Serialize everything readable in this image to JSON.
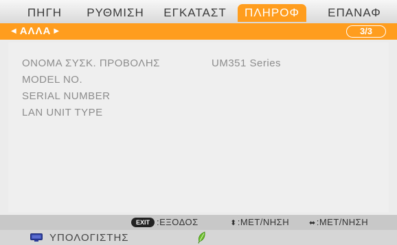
{
  "menu": {
    "tabs": [
      {
        "label": "ΠΗΓΗ",
        "active": false
      },
      {
        "label": "ΡΥΘΜΙΣΗ",
        "active": false
      },
      {
        "label": "ΕΓΚΑΤΑΣΤ",
        "active": false
      },
      {
        "label": "ΠΛΗΡΟΦ",
        "active": true
      },
      {
        "label": "ΕΠΑΝΑΦ",
        "active": false
      }
    ]
  },
  "subheader": {
    "title": "ΑΛΛΑ",
    "left_arrow": "◀",
    "right_arrow": "▶",
    "page_indicator": "3/3"
  },
  "info": {
    "rows": [
      {
        "label": "ΟΝΟΜΑ ΣΥΣΚ. ΠΡΟΒΟΛΗΣ",
        "value": "UM351 Series"
      },
      {
        "label": "MODEL NO.",
        "value": ""
      },
      {
        "label": "SERIAL NUMBER",
        "value": ""
      },
      {
        "label": "LAN UNIT TYPE",
        "value": ""
      }
    ]
  },
  "hints": {
    "exit_badge": "EXIT",
    "exit_label": ":ΕΞΟΔΟΣ",
    "updown_glyph": "⬍",
    "updown_label": ":ΜΕΤ/ΝΗΣΗ",
    "leftright_glyph": "⬌",
    "leftright_label": ":ΜΕΤ/ΝΗΣΗ"
  },
  "status": {
    "source_icon": "monitor-icon",
    "source_label": "ΥΠΟΛΟΓΙΣΤΗΣ",
    "eco_icon": "leaf-icon"
  },
  "colors": {
    "accent": "#ff9d1e",
    "text_dim": "#8c8c8c",
    "eco_green": "#6bbf2a",
    "monitor_blue": "#2e3f9e"
  }
}
